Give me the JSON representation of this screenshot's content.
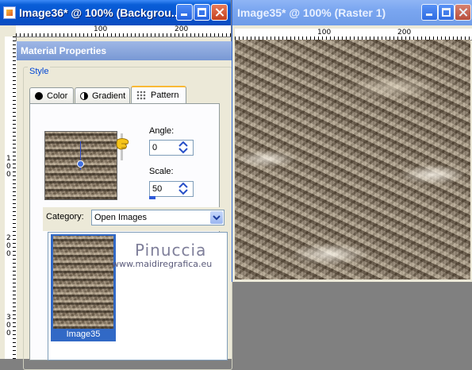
{
  "left_window": {
    "title": "Image36* @ 100% (Backgrou...",
    "ruler_h": [
      "100",
      "200"
    ],
    "ruler_v": [
      "1",
      "0",
      "0",
      "2",
      "0",
      "0",
      "3",
      "0",
      "0"
    ]
  },
  "right_window": {
    "title": "Image35* @ 100% (Raster 1)",
    "ruler_h": [
      "100",
      "200"
    ]
  },
  "panel": {
    "title": "Material Properties",
    "group_label": "Style",
    "tabs": [
      {
        "label": "Color",
        "icon": "color-disc-icon"
      },
      {
        "label": "Gradient",
        "icon": "gradient-disc-icon"
      },
      {
        "label": "Pattern",
        "icon": "pattern-dots-icon"
      }
    ],
    "angle": {
      "label": "Angle:",
      "value": "0"
    },
    "scale": {
      "label": "Scale:",
      "value": "50"
    },
    "category": {
      "label": "Category:",
      "value": "Open Images"
    },
    "list_item": {
      "label": "Image35"
    }
  },
  "watermark": {
    "name": "Pinuccia",
    "url": "www.maidiregrafica.eu"
  },
  "colors": {
    "title_active": "#0553d0",
    "title_inactive": "#7aa6f0",
    "close_button": "#c4411f",
    "selection": "#3169c6",
    "group_title": "#0046d5",
    "tab_highlight": "#f9b934"
  }
}
